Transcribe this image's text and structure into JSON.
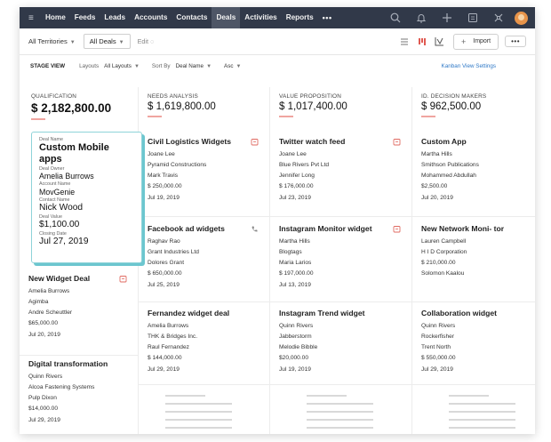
{
  "nav": {
    "items": [
      {
        "label": "Home",
        "active": false
      },
      {
        "label": "Feeds",
        "active": false
      },
      {
        "label": "Leads",
        "active": false
      },
      {
        "label": "Accounts",
        "active": false
      },
      {
        "label": "Contacts",
        "active": false
      },
      {
        "label": "Deals",
        "active": true
      },
      {
        "label": "Activities",
        "active": false
      },
      {
        "label": "Reports",
        "active": false
      }
    ],
    "more": "•••",
    "hamburger": "≡",
    "right_icons": [
      "search-icon",
      "bell-icon",
      "plus-icon",
      "calendar-icon",
      "settings-icon"
    ]
  },
  "toolbar": {
    "territory": "All Territories",
    "view": "All Deals",
    "edit": "Edit",
    "import": "Import",
    "more": "•••",
    "plus": "+"
  },
  "stagebar": {
    "stage_view": "STAGE VIEW",
    "layouts_label": "Layouts",
    "layouts_value": "All Layouts",
    "sortby_label": "Sort By",
    "sortby_value": "Deal Name",
    "order": "Asc",
    "kanban_settings": "Kanban View Settings"
  },
  "columns": [
    {
      "stage": "QUALIFICATION",
      "total": "$ 2,182,800.00",
      "expanded_card": {
        "deal_name_label": "Deal Name",
        "deal_name": "Custom Mobile apps",
        "owner_label": "Deal Owner",
        "owner": "Amelia Burrows",
        "account_label": "Account Name",
        "account": "MovGenie",
        "contact_label": "Contact Name",
        "contact": "Nick Wood",
        "value_label": "Deal Value",
        "value": "$1,100.00",
        "closing_label": "Closing Date",
        "closing": "Jul 27, 2019"
      },
      "cards": [
        {
          "title": "New Widget Deal",
          "icon": "calendar-icon",
          "fields": [
            "Amelia Burrows",
            "Agimba",
            "Andre Scheuttler",
            "$65,000.00",
            "Jul 20, 2019"
          ]
        },
        {
          "title": "Digital transformation",
          "icon": "",
          "fields": [
            "Quinn Rivers",
            "Alcoa Fastening Systems",
            "Pulp Dixon",
            "$14,000.00",
            "Jul 29, 2019"
          ]
        }
      ]
    },
    {
      "stage": "NEEDS ANALYSIS",
      "total": "$ 1,619,800.00",
      "cards": [
        {
          "title": "Civil Logistics Widgets",
          "icon": "calendar-icon",
          "fields": [
            "Joane Lee",
            "Pyramid Constructions",
            "Mark Travis",
            "$ 250,000.00",
            "Jul 19, 2019"
          ]
        },
        {
          "title": "Facebook ad widgets",
          "icon": "phone-icon",
          "fields": [
            "Raghav Rao",
            "Grant Industries Ltd",
            "Dolores Grant",
            "$ 650,000.00",
            "Jul 25, 2019"
          ]
        },
        {
          "title": "Fernandez widget deal",
          "icon": "",
          "fields": [
            "Amelia Burrows",
            "THK & Bridges Inc.",
            "Raul Fernandez",
            "$ 144,000.00",
            "Jul 29, 2019"
          ]
        }
      ]
    },
    {
      "stage": "VALUE PROPOSITION",
      "total": "$ 1,017,400.00",
      "cards": [
        {
          "title": "Twitter watch feed",
          "icon": "calendar-icon",
          "fields": [
            "Joane Lee",
            "Blue Rivers Pvt Ltd",
            "Jennifer Long",
            "$ 176,000.00",
            "Jul 23, 2019"
          ]
        },
        {
          "title": "Instagram Monitor widget",
          "icon": "calendar-icon",
          "fields": [
            "Martha Hills",
            "Blogtags",
            "Maria Larios",
            "$ 197,000.00",
            "Jul 13, 2019"
          ]
        },
        {
          "title": "Instagram Trend widget",
          "icon": "",
          "fields": [
            "Quinn Rivers",
            "Jabberstorm",
            "Melodie Bibble",
            "$20,000.00",
            "Jul 19, 2019"
          ]
        }
      ]
    },
    {
      "stage": "ID. DECISION MAKERS",
      "total": "$ 962,500.00",
      "cards": [
        {
          "title": "Custom App",
          "icon": "",
          "fields": [
            "Martha Hills",
            "Smithson Publications",
            "Mohammed Abdullah",
            "$2,500.00",
            "Jul 20, 2019"
          ]
        },
        {
          "title": "New Network Moni- tor",
          "icon": "",
          "fields": [
            "Lauren Campbell",
            "H I D Corporation",
            "$ 210,000.00",
            "Solomon Kaalou"
          ]
        },
        {
          "title": "Collaboration widget",
          "icon": "",
          "fields": [
            "Quinn Rivers",
            "Rockerfisher",
            "Trent North",
            "$ 550,000.00",
            "Jul 29, 2019"
          ]
        }
      ]
    }
  ],
  "colors": {
    "nav_bg": "#313949",
    "accent_underline": "#f0a5a0",
    "expanded_border": "#6cc6cf",
    "link": "#2f79c7"
  }
}
